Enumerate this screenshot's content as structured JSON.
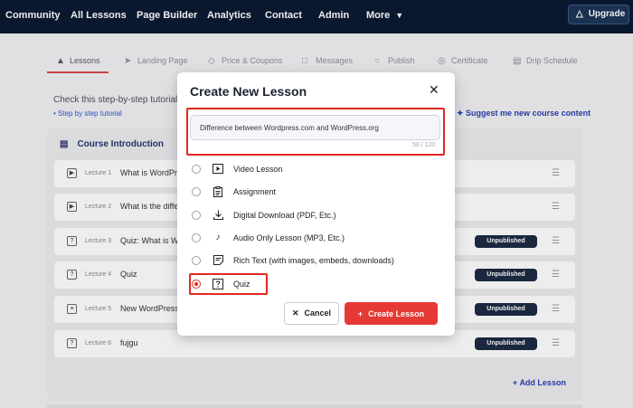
{
  "nav": {
    "items": [
      "Community",
      "All Lessons",
      "Page Builder",
      "Analytics",
      "Contact",
      "Admin",
      "More"
    ],
    "upgrade_label": "Upgrade"
  },
  "tabs": [
    {
      "label": "Lessons",
      "icon": "graduation-cap-icon"
    },
    {
      "label": "Landing Page",
      "icon": "rocket-icon"
    },
    {
      "label": "Price & Coupons",
      "icon": "tag-icon"
    },
    {
      "label": "Messages",
      "icon": "message-icon"
    },
    {
      "label": "Publish",
      "icon": "globe-icon"
    },
    {
      "label": "Certificate",
      "icon": "certificate-icon"
    },
    {
      "label": "Drip Schedule",
      "icon": "calendar-icon"
    }
  ],
  "page": {
    "helper_text": "Check this step-by-step tutorial",
    "helper_link": "Step by step tutorial",
    "suggest_link": "Suggest me new course content",
    "course_title": "Course Introduction",
    "add_lesson": "Add Lesson",
    "rows": [
      {
        "lecture": "Lecture 1",
        "title": "What is WordPre",
        "badge": ""
      },
      {
        "lecture": "Lecture 2",
        "title": "What is the diffe",
        "badge": ""
      },
      {
        "lecture": "Lecture 3",
        "title": "Quiz: What is W",
        "badge": "Unpublished"
      },
      {
        "lecture": "Lecture 4",
        "title": "Quiz",
        "badge": "Unpublished"
      },
      {
        "lecture": "Lecture 5",
        "title": "New WordPress",
        "badge": "Unpublished"
      },
      {
        "lecture": "Lecture 6",
        "title": "fujgu",
        "badge": "Unpublished"
      }
    ]
  },
  "modal": {
    "title": "Create New Lesson",
    "input_value": "Difference between Wordpress.com and WordPress.org",
    "char_count": "50 / 120",
    "options": [
      {
        "label": "Video Lesson",
        "icon": "play-icon",
        "selected": false
      },
      {
        "label": "Assignment",
        "icon": "clipboard-icon",
        "selected": false
      },
      {
        "label": "Digital Download (PDF, Etc.)",
        "icon": "download-icon",
        "selected": false
      },
      {
        "label": "Audio Only Lesson (MP3, Etc.)",
        "icon": "music-note-icon",
        "selected": false
      },
      {
        "label": "Rich Text (with images, embeds, downloads)",
        "icon": "document-icon",
        "selected": false
      },
      {
        "label": "Quiz",
        "icon": "quiz-icon",
        "selected": true
      }
    ],
    "cancel_label": "Cancel",
    "create_label": "Create Lesson"
  },
  "colors": {
    "nav_bg": "#0b1a33",
    "accent": "#e53935",
    "badge_bg": "#1c2a44",
    "link": "#2a3fb0"
  }
}
